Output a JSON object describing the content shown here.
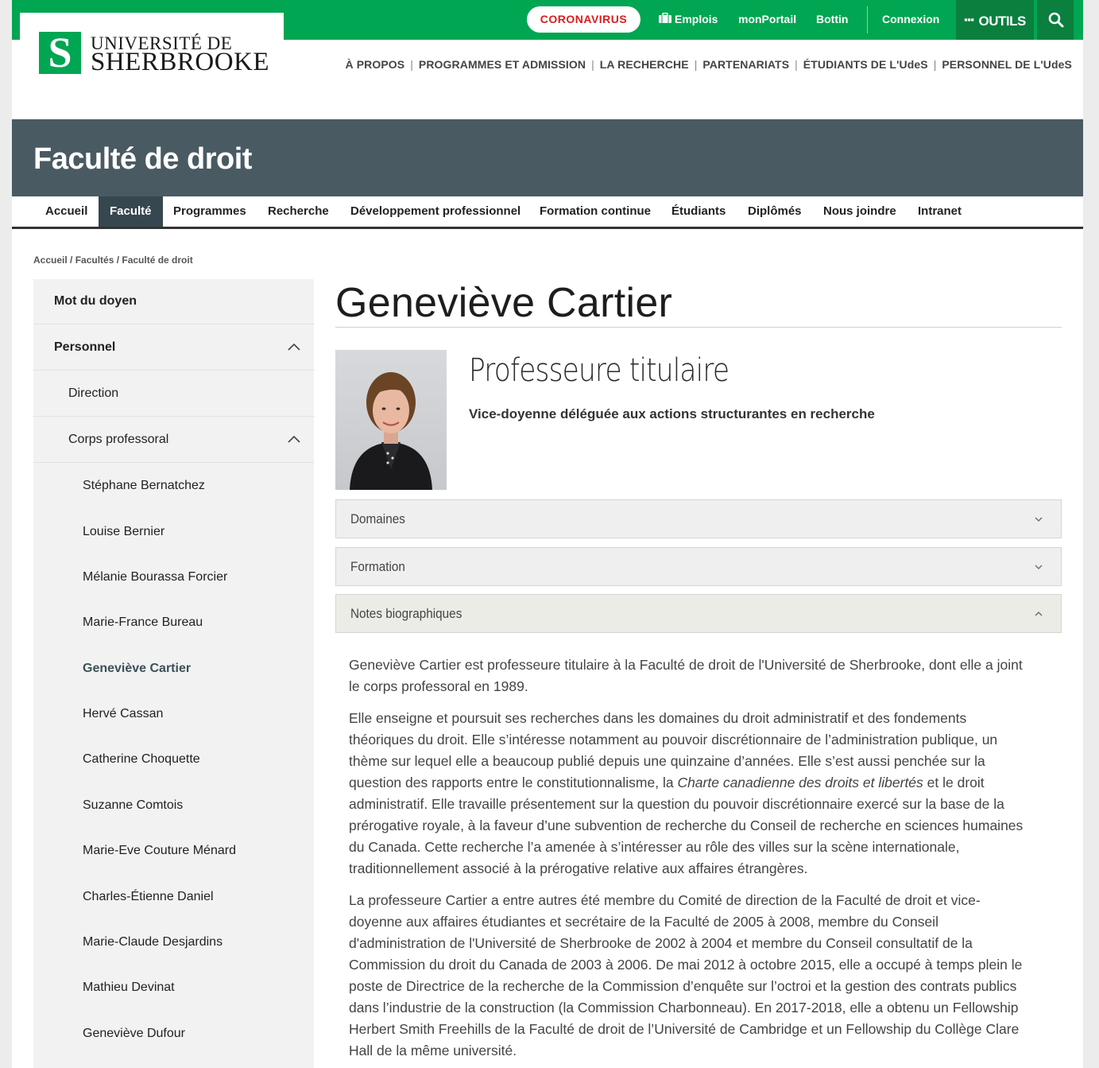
{
  "brand": {
    "line1": "UNIVERSITÉ DE",
    "line2": "SHERBROOKE",
    "mark": "S",
    "green": "#00a651"
  },
  "topbar": {
    "coronavirus": "CORONAVIRUS",
    "emplois": "Emplois",
    "monportail": "monPortail",
    "bottin": "Bottin",
    "connexion": "Connexion",
    "outils": "OUTILS"
  },
  "mainnav": [
    "À PROPOS",
    "PROGRAMMES ET ADMISSION",
    "LA RECHERCHE",
    "PARTENARIATS",
    "ÉTUDIANTS DE L'UdeS",
    "PERSONNEL DE L'UdeS"
  ],
  "banner": {
    "title": "Faculté de droit"
  },
  "subnav": [
    "Accueil",
    "Faculté",
    "Programmes",
    "Recherche",
    "Développement professionnel",
    "Formation continue",
    "Étudiants",
    "Diplômés",
    "Nous joindre",
    "Intranet"
  ],
  "breadcrumb": "Accueil / Facultés / Faculté de droit",
  "sidebar": {
    "items": [
      "Mot du doyen",
      "Personnel",
      "Direction",
      "Corps professoral",
      "Stéphane Bernatchez",
      "Louise Bernier",
      "Mélanie Bourassa Forcier",
      "Marie-France Bureau",
      "Geneviève Cartier",
      "Hervé Cassan",
      "Catherine Choquette",
      "Suzanne Comtois",
      "Marie-Eve Couture Ménard",
      "Charles-Étienne Daniel",
      "Marie-Claude Desjardins",
      "Mathieu Devinat",
      "Geneviève Dufour"
    ]
  },
  "profile": {
    "name": "Geneviève Cartier",
    "role": "Professeure titulaire",
    "subrole": "Vice-doyenne déléguée aux actions structurantes en recherche"
  },
  "accordion": [
    "Domaines",
    "Formation",
    "Notes biographiques"
  ],
  "bio": {
    "p1": "Geneviève Cartier est professeure titulaire à la Faculté de droit de l'Université de Sherbrooke, dont elle a joint le corps professoral en 1989.",
    "p2a": "Elle enseigne et poursuit ses recherches dans les domaines du droit administratif et des fondements théoriques du droit. Elle s’intéresse notamment au pouvoir discrétionnaire de l’administration publique, un thème sur lequel elle a beaucoup publié depuis une quinzaine d’années. Elle s’est aussi penchée sur la question des rapports entre le constitutionnalisme, la ",
    "p2em": "Charte canadienne des droits et libertés",
    "p2b": " et le droit administratif. Elle travaille présentement sur la question du pouvoir discrétionnaire exercé sur la base de la prérogative royale, à la faveur d’une subvention de recherche du Conseil de recherche en sciences humaines du Canada. Cette recherche l’a amenée à s’intéresser au rôle des villes sur la scène internationale, traditionnellement associé à la prérogative relative aux affaires étrangères.",
    "p3": "La professeure Cartier a entre autres été membre du Comité de direction de la Faculté de droit et vice-doyenne aux affaires étudiantes et secrétaire de la Faculté de 2005 à 2008, membre du Conseil d'administration de l'Université de Sherbrooke de 2002 à 2004 et membre du Conseil consultatif de la Commission du droit du Canada de 2003 à 2006. De mai 2012 à octobre 2015, elle a occupé à temps plein le poste de Directrice de la recherche de la Commission d’enquête sur l’octroi et la gestion des contrats publics dans l’industrie de la construction (la Commission Charbonneau). En 2017-2018, elle a obtenu un Fellowship Herbert Smith Freehills de la Faculté de droit de l’Université de Cambridge et un Fellowship du Collège Clare Hall de la même université."
  }
}
